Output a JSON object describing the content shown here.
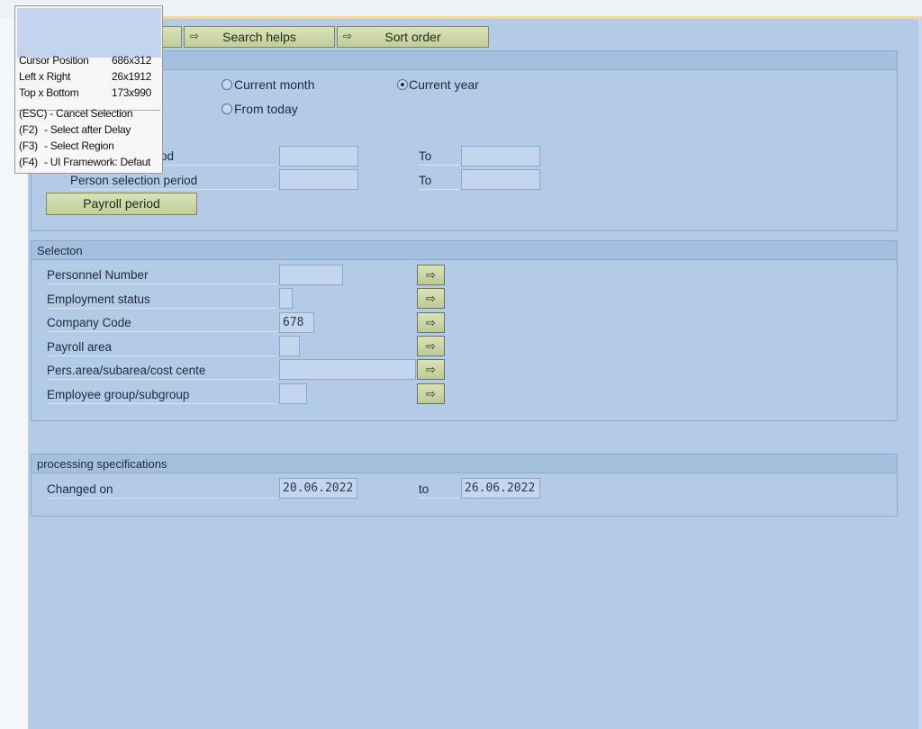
{
  "toolbar": {
    "search_helps": "Search helps",
    "sort_order": "Sort order"
  },
  "period_group": {
    "radio_current_month": "Current month",
    "radio_current_year": "Current year",
    "radio_from_today": "From today",
    "selected": "Current year",
    "data_selection_period_label_partial": "od",
    "person_selection_period_label": "Person selection period",
    "to_label": "To",
    "data_from": "",
    "data_to": "",
    "person_from": "",
    "person_to": "",
    "payroll_period_button": "Payroll period"
  },
  "selection_group": {
    "title": "Selecton",
    "rows": [
      {
        "label": "Personnel Number",
        "value": ""
      },
      {
        "label": "Employment status",
        "value": ""
      },
      {
        "label": "Company Code",
        "value": "678"
      },
      {
        "label": "Payroll area",
        "value": ""
      },
      {
        "label": "Pers.area/subarea/cost cente",
        "value": ""
      },
      {
        "label": "Employee group/subgroup",
        "value": ""
      }
    ]
  },
  "processing_group": {
    "title": "processing specifications",
    "changed_on_label": "Changed on",
    "from_value": "20.06.2022",
    "to_label": "to",
    "to_value": "26.06.2022"
  },
  "popup": {
    "cursor_position_label": "Cursor Position",
    "cursor_position_value": "686x312",
    "left_right_label": "Left x Right",
    "left_right_value": "26x1912",
    "top_bottom_label": "Top x Bottom",
    "top_bottom_value": "173x990",
    "esc_key": "(ESC)",
    "esc_text": "- Cancel Selection",
    "f2_key": "(F2)",
    "f2_text": "- Select after Delay",
    "f3_key": "(F3)",
    "f3_text": "- Select Region",
    "f4_key": "(F4)",
    "f4_text": "- UI Framework: Defaut"
  },
  "icons": {
    "multiple_selection": "arrow-right-icon"
  }
}
